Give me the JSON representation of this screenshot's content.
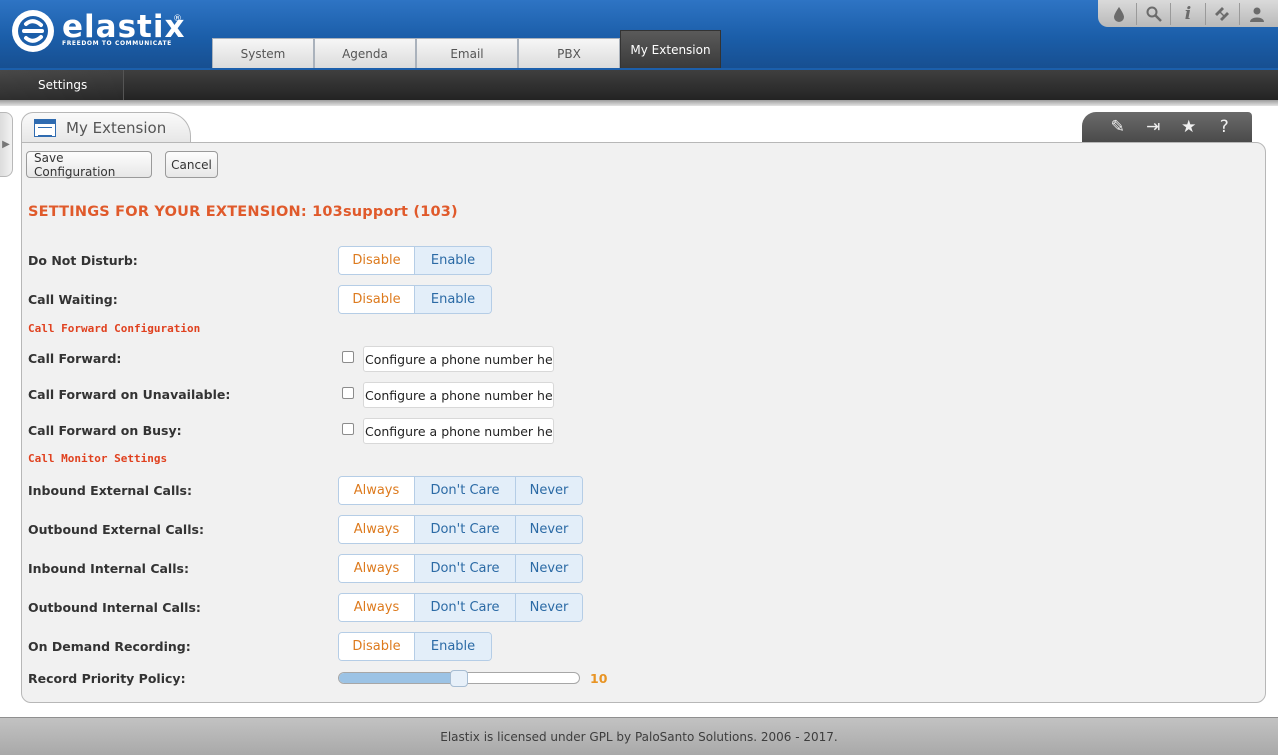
{
  "logo": {
    "name": "elastix",
    "registered": "®",
    "tagline": "FREEDOM TO COMMUNICATE"
  },
  "main_tabs": [
    {
      "label": "System"
    },
    {
      "label": "Agenda"
    },
    {
      "label": "Email"
    },
    {
      "label": "PBX"
    },
    {
      "label": "My Extension",
      "active": true
    }
  ],
  "top_tools": {
    "icons": [
      "theme-icon",
      "search-icon",
      "info-icon",
      "addons-icon",
      "user-icon"
    ]
  },
  "sub_nav": {
    "item": "Settings"
  },
  "panel": {
    "title": "My Extension",
    "tools": [
      "edit-icon",
      "export-icon",
      "star-icon",
      "help-icon"
    ],
    "tool_glyphs": [
      "✎",
      "⇥",
      "★",
      "?"
    ]
  },
  "actions": {
    "save_label": "Save Configuration",
    "cancel_label": "Cancel"
  },
  "heading": "SETTINGS FOR YOUR EXTENSION: 103support (103)",
  "dnd": {
    "label": "Do Not Disturb:",
    "options": [
      "Disable",
      "Enable"
    ],
    "selected": "Disable"
  },
  "call_waiting": {
    "label": "Call Waiting:",
    "options": [
      "Disable",
      "Enable"
    ],
    "selected": "Disable"
  },
  "call_forward_section": "Call Forward Configuration",
  "call_forward": {
    "label": "Call Forward:",
    "checked": false,
    "value": "Configure a phone number here"
  },
  "call_forward_unavailable": {
    "label": "Call Forward on Unavailable:",
    "checked": false,
    "value": "Configure a phone number here"
  },
  "call_forward_busy": {
    "label": "Call Forward on Busy:",
    "checked": false,
    "value": "Configure a phone number here"
  },
  "call_monitor_section": "Call Monitor Settings",
  "inbound_external": {
    "label": "Inbound External Calls:",
    "options": [
      "Always",
      "Don't Care",
      "Never"
    ],
    "selected": "Always"
  },
  "outbound_external": {
    "label": "Outbound External Calls:",
    "options": [
      "Always",
      "Don't Care",
      "Never"
    ],
    "selected": "Always"
  },
  "inbound_internal": {
    "label": "Inbound Internal Calls:",
    "options": [
      "Always",
      "Don't Care",
      "Never"
    ],
    "selected": "Always"
  },
  "outbound_internal": {
    "label": "Outbound Internal Calls:",
    "options": [
      "Always",
      "Don't Care",
      "Never"
    ],
    "selected": "Always"
  },
  "on_demand": {
    "label": "On Demand Recording:",
    "options": [
      "Disable",
      "Enable"
    ],
    "selected": "Disable"
  },
  "record_priority": {
    "label": "Record Priority Policy:",
    "value": 10,
    "min": 0,
    "max": 20
  },
  "footer": "Elastix is licensed under GPL by PaloSanto Solutions. 2006 - 2017.",
  "colors": {
    "brand_blue": "#1b5ea9",
    "heading_orange": "#e05a2b",
    "section_red": "#e0411f",
    "selected_orange": "#dd7a1d"
  }
}
